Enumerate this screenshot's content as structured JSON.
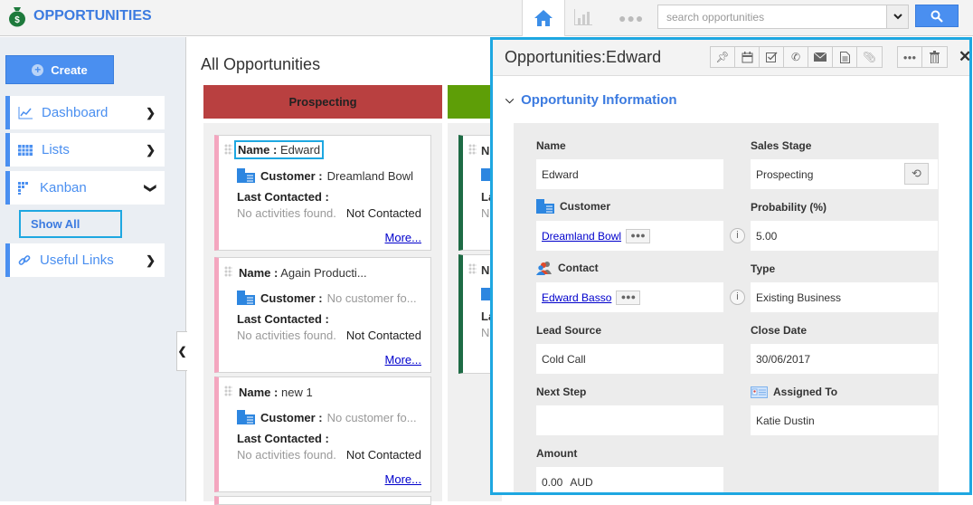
{
  "header": {
    "app_title": "OPPORTUNITIES",
    "search_placeholder": "search opportunities",
    "nav_icons": [
      "home-icon",
      "chart-icon",
      "more-icon"
    ]
  },
  "sidebar": {
    "create_label": "Create",
    "items": [
      {
        "label": "Dashboard",
        "icon": "dashboard-icon",
        "state": "collapsed"
      },
      {
        "label": "Lists",
        "icon": "lists-icon",
        "state": "collapsed"
      },
      {
        "label": "Kanban",
        "icon": "kanban-icon",
        "state": "expanded"
      },
      {
        "label": "Useful Links",
        "icon": "link-icon",
        "state": "collapsed"
      }
    ],
    "kanban_sub": {
      "label": "Show All"
    }
  },
  "main": {
    "title": "All Opportunities",
    "columns": [
      {
        "label": "Prospecting",
        "color": "#b94040"
      },
      {
        "label": "",
        "color": "#5e9e07"
      }
    ],
    "cards": [
      {
        "name_label": "Name :",
        "name": "Edward",
        "customer_label": "Customer :",
        "customer": "Dreamland Bowl",
        "last_contacted_label": "Last Contacted :",
        "activities": "No activities found.",
        "status": "Not Contacted",
        "more": "More..."
      },
      {
        "name_label": "Name :",
        "name": "Again Producti...",
        "customer_label": "Customer :",
        "customer": "No customer fo...",
        "last_contacted_label": "Last Contacted :",
        "activities": "No activities found.",
        "status": "Not Contacted",
        "more": "More..."
      },
      {
        "name_label": "Name :",
        "name": "new 1",
        "customer_label": "Customer :",
        "customer": "No customer fo...",
        "last_contacted_label": "Last Contacted :",
        "activities": "No activities found.",
        "status": "Not Contacted",
        "more": "More..."
      }
    ],
    "partial_cards": [
      {
        "name_initial": "N",
        "lc_initial": "La",
        "act_initial": "N"
      },
      {
        "name_initial": "N",
        "lc_initial": "La",
        "act_initial": "N"
      }
    ]
  },
  "panel": {
    "title": "Opportunities:Edward",
    "toolbar": [
      "pin-icon",
      "calendar-icon",
      "task-icon",
      "phone-icon",
      "email-icon",
      "note-icon",
      "attachment-icon"
    ],
    "toolbar2": [
      "more-icon",
      "trash-icon"
    ],
    "section_title": "Opportunity Information",
    "fields": {
      "name": {
        "label": "Name",
        "value": "Edward"
      },
      "sales_stage": {
        "label": "Sales Stage",
        "value": "Prospecting"
      },
      "customer": {
        "label": "Customer",
        "value": "Dreamland Bowl"
      },
      "probability": {
        "label": "Probability (%)",
        "value": "5.00"
      },
      "contact": {
        "label": "Contact",
        "value": "Edward Basso"
      },
      "type": {
        "label": "Type",
        "value": "Existing Business"
      },
      "lead_source": {
        "label": "Lead Source",
        "value": "Cold Call"
      },
      "close_date": {
        "label": "Close Date",
        "value": "30/06/2017"
      },
      "next_step": {
        "label": "Next Step",
        "value": ""
      },
      "assigned_to": {
        "label": "Assigned To",
        "value": "Katie Dustin"
      },
      "amount": {
        "label": "Amount",
        "value": "0.00",
        "currency": "AUD"
      }
    }
  }
}
